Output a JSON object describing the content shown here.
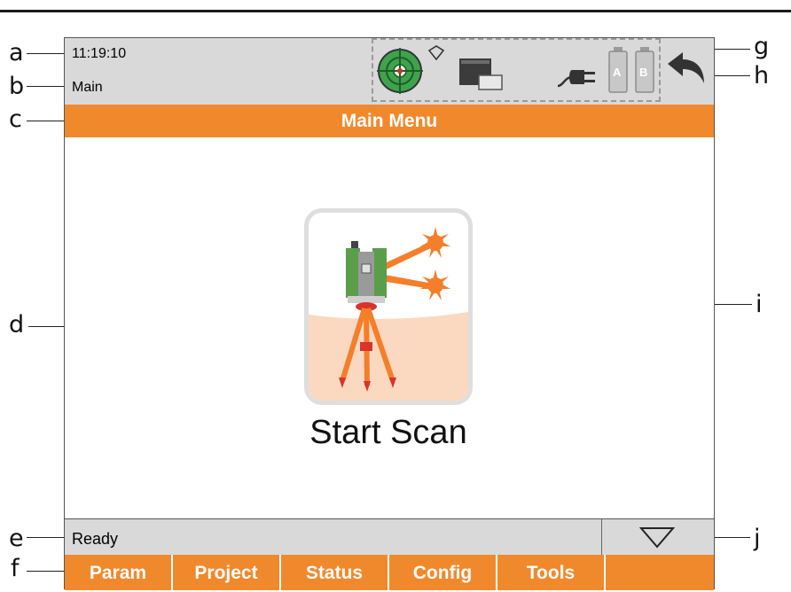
{
  "status": {
    "time": "11:19:10",
    "mode": "Main"
  },
  "header": {
    "title": "Main Menu"
  },
  "content": {
    "tile_label": "Start Scan"
  },
  "message": {
    "text": "Ready"
  },
  "softkeys": [
    {
      "label": "Param"
    },
    {
      "label": "Project"
    },
    {
      "label": "Status"
    },
    {
      "label": "Config"
    },
    {
      "label": "Tools"
    },
    {
      "label": ""
    }
  ],
  "battery": {
    "slot_a": "A",
    "slot_b": "B"
  },
  "callouts": {
    "a": "a",
    "b": "b",
    "c": "c",
    "d": "d",
    "e": "e",
    "f": "f",
    "g": "g",
    "h": "h",
    "i": "i",
    "j": "j"
  },
  "icons": {
    "level": "level-bubble-icon",
    "wireless": "wireless-icon",
    "memory": "memory-card-icon",
    "power": "power-plug-icon",
    "battery": "battery-ab-icon",
    "back": "back-arrow-icon",
    "expand": "triangle-down-icon",
    "scanner": "scanner-on-tripod-icon"
  },
  "colors": {
    "accent": "#f0892c",
    "bar_gray": "#d9d9d9",
    "level_green": "#3fa34d"
  }
}
